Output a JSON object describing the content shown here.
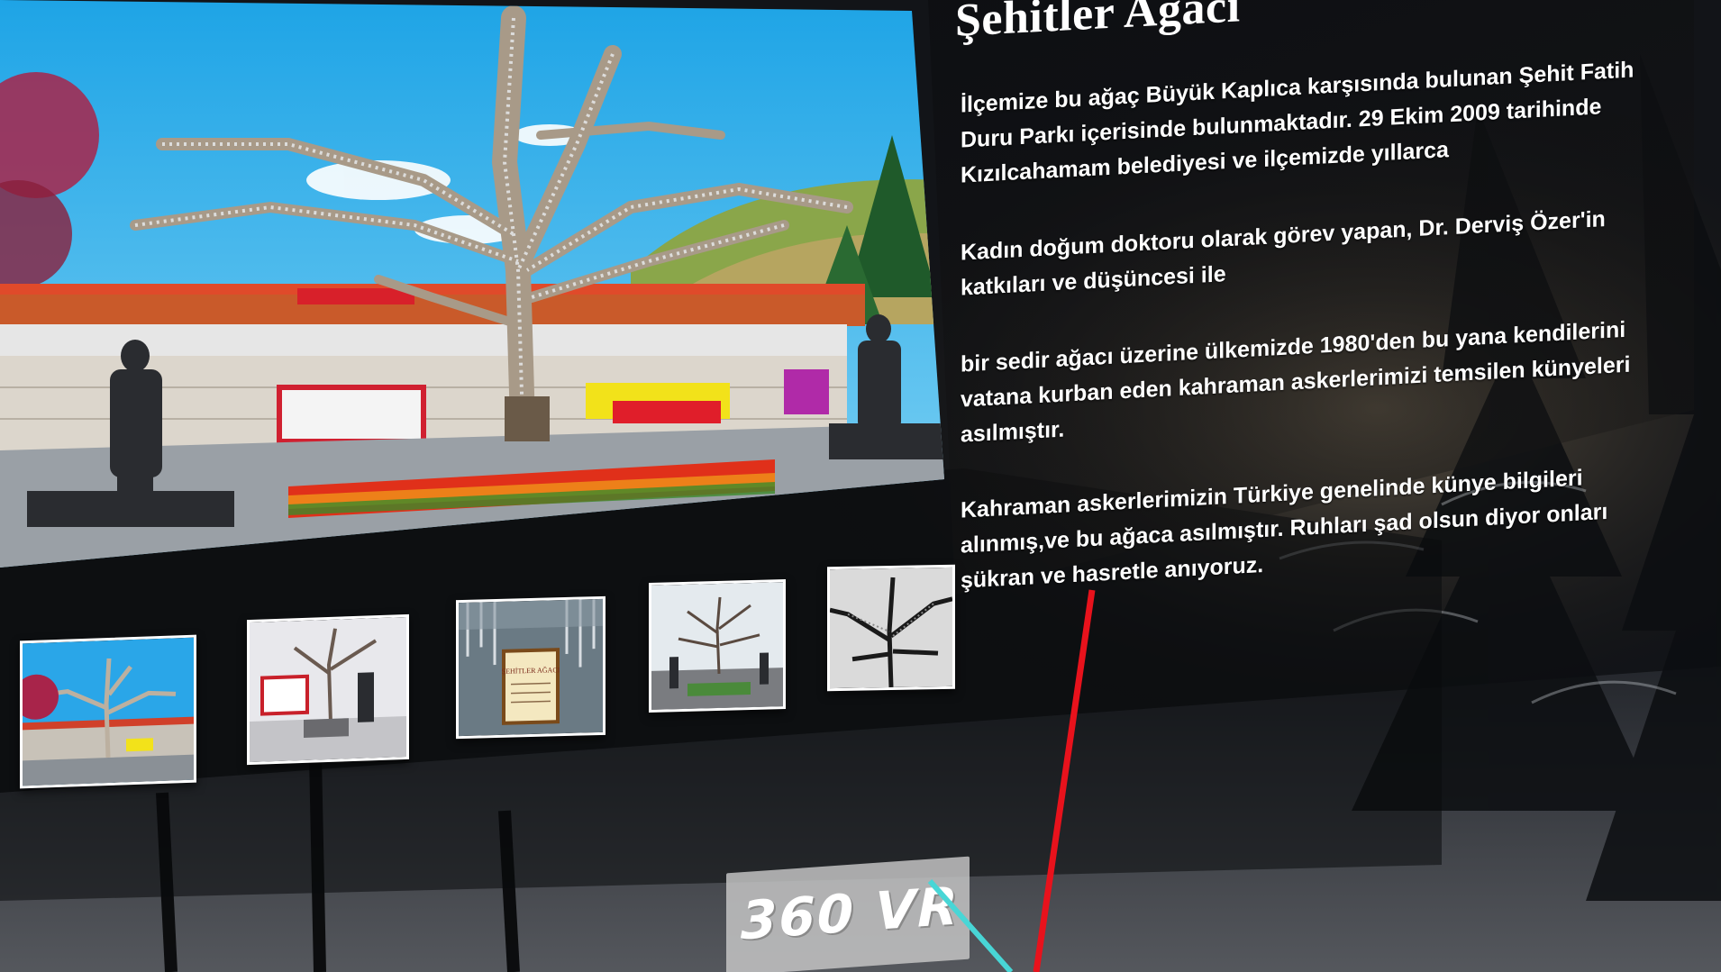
{
  "panel": {
    "title": "Şehitler Ağacı",
    "paragraphs": [
      "İlçemize bu ağaç Büyük Kaplıca karşısında bulunan Şehit Fatih Duru Parkı içerisinde bulunmaktadır. 29 Ekim 2009 tarihinde Kızılcahamam belediyesi ve ilçemizde yıllarca",
      "Kadın doğum doktoru olarak görev yapan, Dr. Derviş Özer'in katkıları ve düşüncesi ile",
      "bir sedir ağacı üzerine ülkemizde 1980'den bu yana kendilerini vatana kurban eden kahraman askerlerimizi temsilen künyeleri asılmıştır.",
      "Kahraman askerlerimizin Türkiye genelinde künye bilgileri alınmış,ve bu ağaca asılmıştır. Ruhları şad olsun diyor onları şükran ve hasretle anıyoruz."
    ]
  },
  "gallery": {
    "thumbnails": [
      "thumb-photo-1",
      "thumb-photo-2",
      "thumb-photo-3",
      "thumb-photo-4",
      "thumb-photo-5"
    ],
    "thumb3_sign_text": "ŞEHİTLER AĞACI"
  },
  "vr_button": {
    "label": "360 VR"
  },
  "colors": {
    "sky": "#34b6ec",
    "laser_red": "#e8121c",
    "laser_cyan": "#48d6d6",
    "button_bg": "#c8c8c8"
  }
}
